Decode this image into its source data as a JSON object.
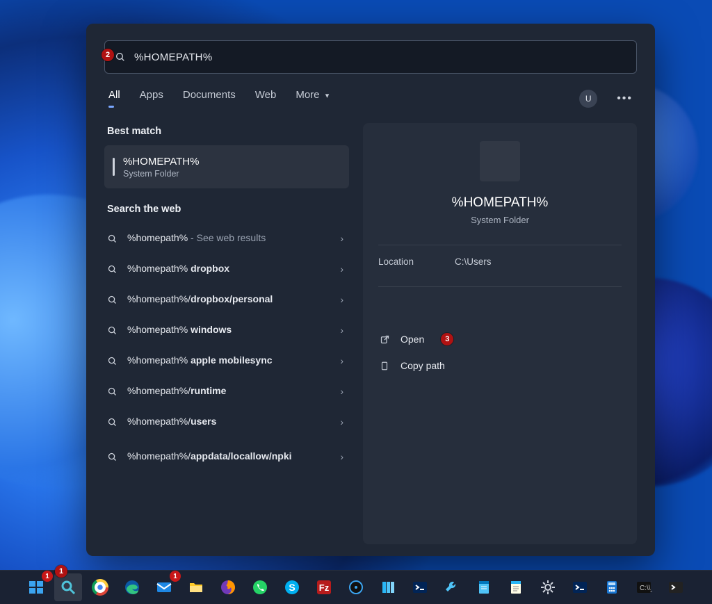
{
  "annotations": {
    "a1": "1",
    "a2": "2",
    "a3": "3"
  },
  "search": {
    "value": "%HOMEPATH%"
  },
  "tabs": {
    "all": "All",
    "apps": "Apps",
    "documents": "Documents",
    "web": "Web",
    "more": "More"
  },
  "user_initial": "U",
  "sections": {
    "best_match": "Best match",
    "search_web": "Search the web"
  },
  "best_match": {
    "title": "%HOMEPATH%",
    "subtitle": "System Folder"
  },
  "web_results": [
    {
      "prefix": "%homepath%",
      "bold": "",
      "suffix": " - See web results"
    },
    {
      "prefix": "%homepath% ",
      "bold": "dropbox",
      "suffix": ""
    },
    {
      "prefix": "%homepath%/",
      "bold": "dropbox/personal",
      "suffix": ""
    },
    {
      "prefix": "%homepath% ",
      "bold": "windows",
      "suffix": ""
    },
    {
      "prefix": "%homepath% ",
      "bold": "apple mobilesync",
      "suffix": ""
    },
    {
      "prefix": "%homepath%/",
      "bold": "runtime",
      "suffix": ""
    },
    {
      "prefix": "%homepath%/",
      "bold": "users",
      "suffix": ""
    },
    {
      "prefix": "%homepath%/",
      "bold": "appdata/locallow/npki",
      "suffix": "",
      "tall": true
    }
  ],
  "details": {
    "title": "%HOMEPATH%",
    "subtitle": "System Folder",
    "location_label": "Location",
    "location_value": "C:\\Users",
    "open": "Open",
    "copy_path": "Copy path"
  },
  "taskbar": [
    {
      "name": "start-button",
      "badge": "1",
      "bg": "transparent",
      "svg": "win"
    },
    {
      "name": "search-button",
      "active": true,
      "bg": "transparent",
      "svg": "search-tb"
    },
    {
      "name": "chrome",
      "bg": "transparent",
      "svg": "chrome"
    },
    {
      "name": "edge",
      "bg": "transparent",
      "svg": "edge"
    },
    {
      "name": "mail",
      "badge": "1",
      "bg": "transparent",
      "svg": "mail"
    },
    {
      "name": "file-explorer",
      "bg": "transparent",
      "svg": "folder"
    },
    {
      "name": "firefox",
      "bg": "transparent",
      "svg": "firefox"
    },
    {
      "name": "whatsapp",
      "bg": "transparent",
      "svg": "whatsapp"
    },
    {
      "name": "skype",
      "bg": "transparent",
      "svg": "skype"
    },
    {
      "name": "filezilla",
      "bg": "transparent",
      "svg": "fz"
    },
    {
      "name": "media-player",
      "bg": "transparent",
      "svg": "disc"
    },
    {
      "name": "books",
      "bg": "transparent",
      "svg": "books"
    },
    {
      "name": "powershell",
      "bg": "transparent",
      "svg": "ps"
    },
    {
      "name": "tool-a",
      "bg": "transparent",
      "svg": "wrench"
    },
    {
      "name": "notes",
      "bg": "transparent",
      "svg": "notes"
    },
    {
      "name": "notepad",
      "bg": "transparent",
      "svg": "notepad"
    },
    {
      "name": "settings",
      "bg": "transparent",
      "svg": "gear"
    },
    {
      "name": "terminal-blue",
      "bg": "transparent",
      "svg": "ps"
    },
    {
      "name": "calculator",
      "bg": "transparent",
      "svg": "calc"
    },
    {
      "name": "cmd",
      "bg": "transparent",
      "svg": "cmd"
    },
    {
      "name": "terminal",
      "bg": "transparent",
      "svg": "term"
    }
  ]
}
